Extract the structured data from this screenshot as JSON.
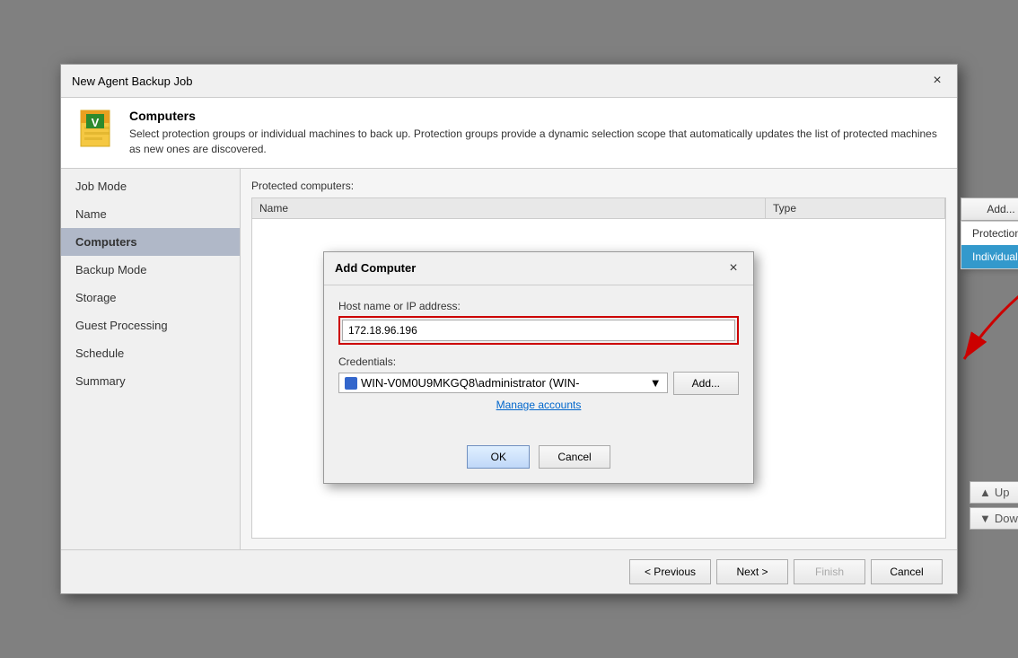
{
  "window": {
    "title": "New Agent Backup Job",
    "close_label": "×"
  },
  "header": {
    "title": "Computers",
    "description": "Select protection groups or individual machines to back up. Protection groups provide a dynamic selection scope that automatically updates the list of protected machines as new ones are discovered."
  },
  "sidebar": {
    "items": [
      {
        "id": "job-mode",
        "label": "Job Mode"
      },
      {
        "id": "name",
        "label": "Name"
      },
      {
        "id": "computers",
        "label": "Computers",
        "active": true
      },
      {
        "id": "backup-mode",
        "label": "Backup Mode"
      },
      {
        "id": "storage",
        "label": "Storage"
      },
      {
        "id": "guest-processing",
        "label": "Guest Processing"
      },
      {
        "id": "schedule",
        "label": "Schedule"
      },
      {
        "id": "summary",
        "label": "Summary"
      }
    ]
  },
  "content": {
    "section_label": "Protected computers:",
    "table": {
      "columns": [
        "Name",
        "Type"
      ],
      "rows": []
    },
    "add_button": "Add...",
    "dropdown": {
      "items": [
        "Protection group...",
        "Individual computer..."
      ],
      "selected": "Individual computer..."
    },
    "up_button": "Up",
    "down_button": "Down"
  },
  "add_computer_modal": {
    "title": "Add Computer",
    "close_label": "×",
    "host_label": "Host name or IP address:",
    "host_value": "172.18.96.196",
    "credentials_label": "Credentials:",
    "credentials_value": "WIN-V0M0U9MKGQ8\\administrator (WIN-",
    "credentials_add": "Add...",
    "manage_link": "Manage accounts",
    "ok_button": "OK",
    "cancel_button": "Cancel"
  },
  "bottom_nav": {
    "previous": "< Previous",
    "next": "Next >",
    "finish": "Finish",
    "cancel": "Cancel"
  }
}
